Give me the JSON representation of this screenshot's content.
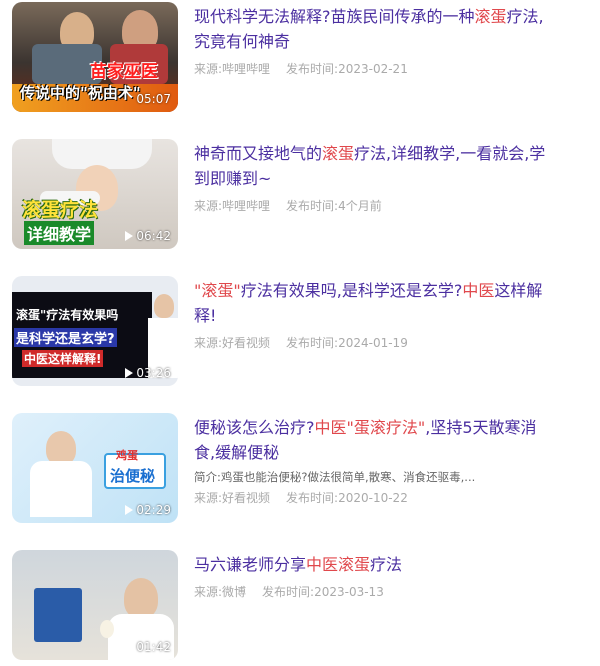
{
  "items": [
    {
      "title_parts": [
        "现代科学无法解释?苗族民间传承的一种",
        "滚蛋",
        "疗法,究竟有何神奇"
      ],
      "source": "来源:哔哩哔哩",
      "date": "发布时间:2023-02-21",
      "duration": "05:07",
      "overlay": [
        "苗家巫医",
        "传说中的\"祝由术\""
      ]
    },
    {
      "title_parts": [
        "神奇而又接地气的",
        "滚蛋",
        "疗法,详细教学,一看就会,学到即赚到~"
      ],
      "source": "来源:哔哩哔哩",
      "date": "发布时间:4个月前",
      "duration": "06:42",
      "overlay": [
        "滚蛋疗法",
        "详细教学"
      ]
    },
    {
      "title_parts": [
        "\"滚蛋\"",
        "疗法有效果吗,是科学还是玄学?",
        "中医",
        "这样解释!"
      ],
      "source": "来源:好看视频",
      "date": "发布时间:2024-01-19",
      "duration": "03:26",
      "overlay": [
        "滚蛋\"疗法有效果吗",
        "是科学还是玄学?",
        "中医这样解释!"
      ]
    },
    {
      "title_parts": [
        "便秘该怎么治疗?",
        "中医",
        "\"蛋滚疗法\"",
        ",坚持5天散寒消食,缓解便秘"
      ],
      "summary": "简介:鸡蛋也能治便秘?做法很简单,散寒、消食还驱毒,...",
      "source": "来源:好看视频",
      "date": "发布时间:2020-10-22",
      "duration": "02:29",
      "overlay": [
        "鸡蛋",
        "治便秘"
      ]
    },
    {
      "title_parts": [
        "马六谦老师分享",
        "中医滚蛋",
        "疗法"
      ],
      "source": "来源:微博",
      "date": "发布时间:2023-03-13",
      "duration": "01:42",
      "overlay": []
    }
  ],
  "colors": {
    "title": "#4b2fa0",
    "highlight": "#e0484c",
    "meta": "#aaaaaa"
  }
}
